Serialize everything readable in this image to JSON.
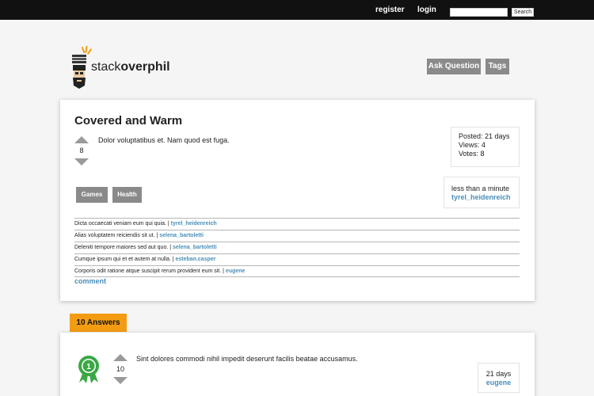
{
  "topbar": {
    "register": "register",
    "login": "login",
    "search_placeholder": "",
    "search_button": "Search"
  },
  "logo": {
    "text_light": "stack",
    "text_bold": "overphil"
  },
  "nav": {
    "ask_question": "Ask Question",
    "tags": "Tags"
  },
  "question": {
    "title": "Covered and Warm",
    "votes": "8",
    "body": "Dolor voluptatibus et. Nam quod est fuga.",
    "posted": "Posted: 21 days",
    "views": "Views: 4",
    "vote_count": "Votes: 8",
    "tags": [
      "Games",
      "Health"
    ],
    "owner_time": "less than a minute",
    "owner_name": "tyrel_heidenreich",
    "comments": [
      {
        "text": "Dicta occaecati veniam eum qui quia.",
        "sep": " | ",
        "user": "tyrel_heidenreich"
      },
      {
        "text": "Alias voluptatem reiciendis sit ut.",
        "sep": " | ",
        "user": "selena_bartoletti"
      },
      {
        "text": "Deleniti tempore maiores sed aut quo.",
        "sep": " | ",
        "user": "selena_bartoletti"
      },
      {
        "text": "Cumque ipsum qui et et autem at nulla.",
        "sep": " | ",
        "user": "esteban.casper"
      },
      {
        "text": "Corporis odit ratione atque suscipit rerum provident eum sit.",
        "sep": " | ",
        "user": "eugene"
      }
    ],
    "comment_link": "comment"
  },
  "answers": {
    "heading": "10 Answers",
    "items": [
      {
        "votes": "10",
        "body": "Sint dolores commodi nihil impedit deserunt facilis beatae accusamus.",
        "time": "21 days",
        "user": "eugene",
        "accepted_number": "1"
      }
    ]
  },
  "colors": {
    "accent": "#f39c12",
    "link": "#4a8fb8",
    "button_gray": "#8a8a8a",
    "topbar": "#111111",
    "award_green": "#3aa845"
  }
}
